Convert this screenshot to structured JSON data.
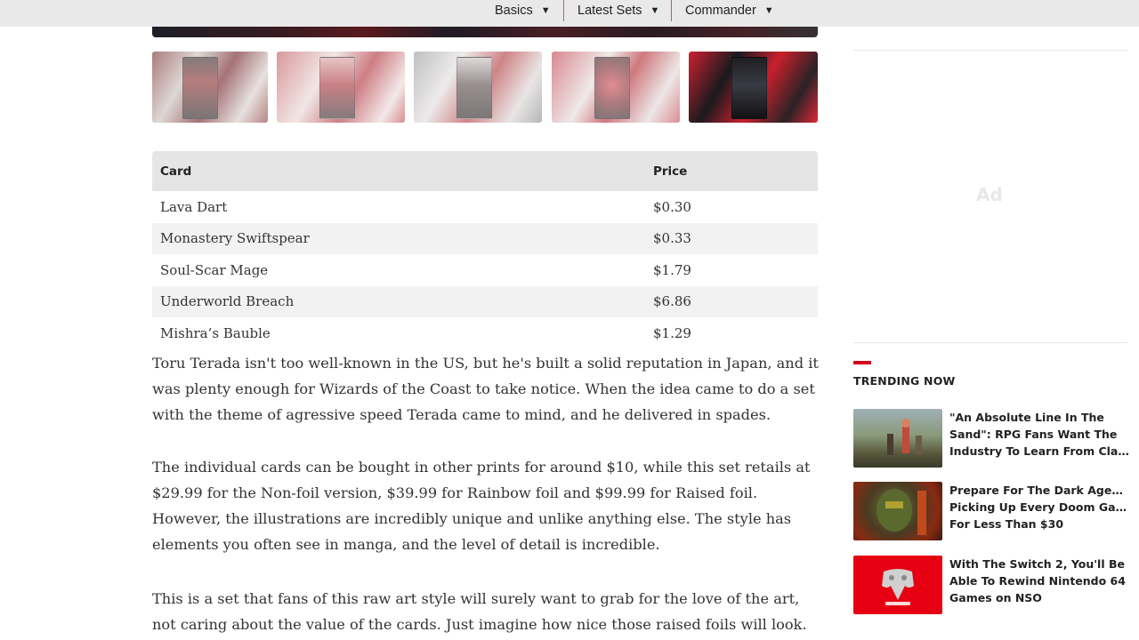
{
  "nav": {
    "items": [
      {
        "label": "Basics"
      },
      {
        "label": "Latest Sets"
      },
      {
        "label": "Commander"
      }
    ],
    "caret": "▼"
  },
  "gallery": {
    "thumbnails": [
      {
        "name": "card-art-1"
      },
      {
        "name": "card-art-2"
      },
      {
        "name": "card-art-3"
      },
      {
        "name": "card-art-4"
      },
      {
        "name": "card-art-5"
      }
    ]
  },
  "table": {
    "headers": {
      "card": "Card",
      "price": "Price"
    },
    "rows": [
      {
        "card": "Lava Dart",
        "price": "$0.30"
      },
      {
        "card": "Monastery Swiftspear",
        "price": "$0.33"
      },
      {
        "card": "Soul-Scar Mage",
        "price": "$1.79"
      },
      {
        "card": "Underworld Breach",
        "price": "$6.86"
      },
      {
        "card": "Mishra’s Bauble",
        "price": "$1.29"
      }
    ]
  },
  "article": {
    "paragraphs": [
      "Toru Terada isn't too well-known in the US, but he's built a solid reputation in Japan, and it was plenty enough for Wizards of the Coast to take notice. When the idea came to do a set with the theme of agressive speed Terada came to mind, and he delivered in spades.",
      "The individual cards can be bought in other prints for around $10, while this set retails at $29.99 for the Non-foil version, $39.99 for Rainbow foil and $99.99 for Raised foil. However, the illustrations are incredibly unique and unlike anything else. The style has elements you often see in manga, and the level of detail is incredible.",
      "This is a set that fans of this raw art style will surely want to grab for the love of the art, not caring about the value of the cards. Just imagine how nice those raised foils will look."
    ]
  },
  "sidebar": {
    "ad_label": "Ad",
    "trending_title": "TRENDING NOW",
    "trending": [
      {
        "lines": [
          "\"An Absolute Line In The",
          "Sand\": RPG Fans Want The",
          "Industry To Learn From Clair..."
        ]
      },
      {
        "lines": [
          "Prepare For The Dark Ages By",
          "Picking Up Every Doom Game",
          "For Less Than $30"
        ]
      },
      {
        "lines": [
          "With The Switch 2, You'll Be",
          "Able To Rewind Nintendo 64",
          "Games on NSO"
        ]
      }
    ]
  },
  "colors": {
    "accent": "#d0021b",
    "nav_bg": "#e9e9e9",
    "table_header_bg": "#e5e5e5",
    "row_alt_bg": "#f2f2f2"
  }
}
